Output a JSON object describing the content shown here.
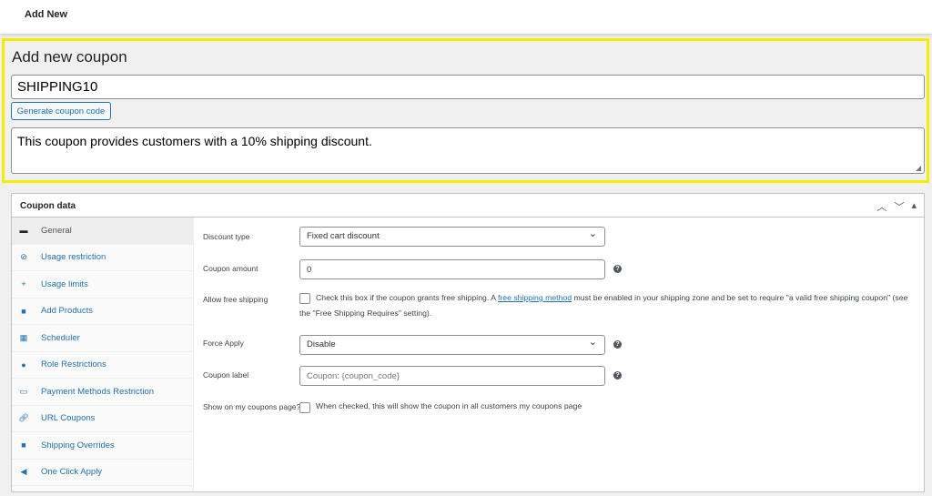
{
  "topbar": {
    "title": "Add New"
  },
  "coupon": {
    "heading": "Add new coupon",
    "code": "SHIPPING10",
    "generate_label": "Generate coupon code",
    "description": "This coupon provides customers with a 10% shipping discount."
  },
  "panel": {
    "title": "Coupon data",
    "tabs": [
      {
        "label": "General",
        "icon": "ticket-icon"
      },
      {
        "label": "Usage restriction",
        "icon": "block-icon"
      },
      {
        "label": "Usage limits",
        "icon": "plus-icon"
      },
      {
        "label": "Add Products",
        "icon": "bag-icon"
      },
      {
        "label": "Scheduler",
        "icon": "calendar-icon"
      },
      {
        "label": "Role Restrictions",
        "icon": "user-icon"
      },
      {
        "label": "Payment Methods Restriction",
        "icon": "card-icon"
      },
      {
        "label": "URL Coupons",
        "icon": "link-icon"
      },
      {
        "label": "Shipping Overrides",
        "icon": "truck-icon"
      },
      {
        "label": "One Click Apply",
        "icon": "megaphone-icon"
      }
    ],
    "fields": {
      "discount_type": {
        "label": "Discount type",
        "value": "Fixed cart discount"
      },
      "amount": {
        "label": "Coupon amount",
        "value": "0"
      },
      "free_shipping": {
        "label": "Allow free shipping",
        "text_before": "Check this box if the coupon grants free shipping. A ",
        "link": "free shipping method",
        "text_after": " must be enabled in your shipping zone and be set to require \"a valid free shipping coupon\" (see the \"Free Shipping Requires\" setting).",
        "checked": false
      },
      "force_apply": {
        "label": "Force Apply",
        "value": "Disable"
      },
      "coupon_label": {
        "label": "Coupon label",
        "placeholder": "Coupon: {coupon_code}"
      },
      "show_my_coupons": {
        "label": "Show on my coupons page?",
        "text": "When checked, this will show the coupon in all customers my coupons page",
        "checked": false
      }
    }
  },
  "colors": {
    "highlight": "#f5ec00",
    "link": "#2271b1"
  }
}
